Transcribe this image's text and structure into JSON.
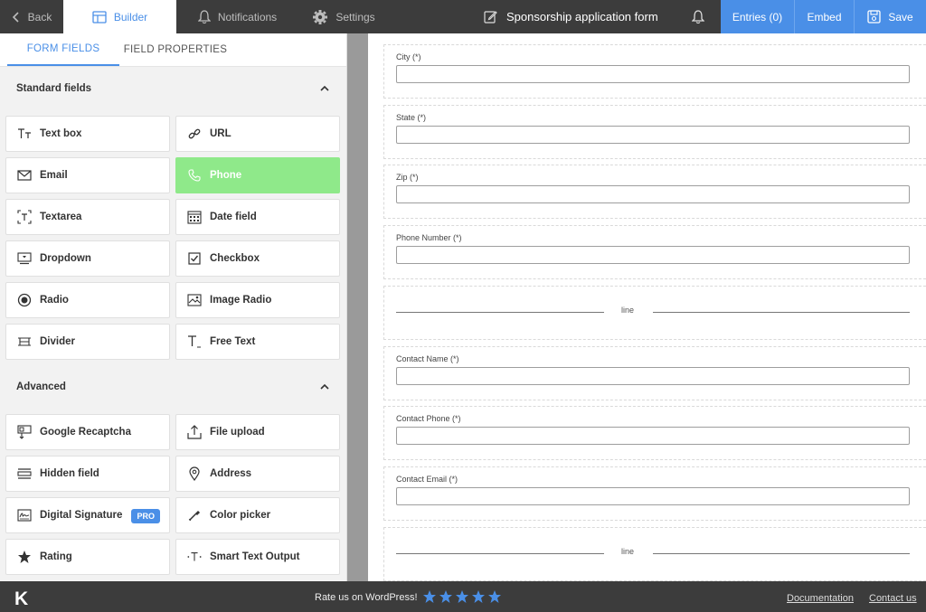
{
  "topbar": {
    "back": "Back",
    "builder": "Builder",
    "notifications": "Notifications",
    "settings": "Settings",
    "form_title": "Sponsorship application form",
    "entries": "Entries (0)",
    "embed": "Embed",
    "save": "Save"
  },
  "sidebar": {
    "tabs": [
      "FORM FIELDS",
      "FIELD PROPERTIES"
    ],
    "standard": {
      "title": "Standard fields",
      "items": [
        {
          "label": "Text box",
          "icon": "text-box-icon"
        },
        {
          "label": "URL",
          "icon": "link-icon"
        },
        {
          "label": "Email",
          "icon": "envelope-icon"
        },
        {
          "label": "Phone",
          "icon": "phone-icon"
        },
        {
          "label": "Textarea",
          "icon": "textarea-icon"
        },
        {
          "label": "Date field",
          "icon": "calendar-icon"
        },
        {
          "label": "Dropdown",
          "icon": "dropdown-icon"
        },
        {
          "label": "Checkbox",
          "icon": "checkbox-icon"
        },
        {
          "label": "Radio",
          "icon": "radio-icon"
        },
        {
          "label": "Image Radio",
          "icon": "image-radio-icon"
        },
        {
          "label": "Divider",
          "icon": "divider-icon"
        },
        {
          "label": "Free Text",
          "icon": "free-text-icon"
        }
      ]
    },
    "advanced": {
      "title": "Advanced",
      "items": [
        {
          "label": "Google Recaptcha",
          "icon": "recaptcha-icon"
        },
        {
          "label": "File upload",
          "icon": "upload-icon"
        },
        {
          "label": "Hidden field",
          "icon": "hidden-field-icon"
        },
        {
          "label": "Address",
          "icon": "map-pin-icon"
        },
        {
          "label": "Digital Signature",
          "icon": "signature-icon",
          "badge": "PRO"
        },
        {
          "label": "Color picker",
          "icon": "color-picker-icon"
        },
        {
          "label": "Rating",
          "icon": "star-icon"
        },
        {
          "label": "Smart Text Output",
          "icon": "smart-text-icon"
        }
      ]
    }
  },
  "canvas": {
    "fields": [
      {
        "type": "input",
        "label": "City (*)"
      },
      {
        "type": "input",
        "label": "State (*)"
      },
      {
        "type": "input",
        "label": "Zip (*)"
      },
      {
        "type": "input",
        "label": "Phone Number (*)"
      },
      {
        "type": "line",
        "label": "line"
      },
      {
        "type": "input",
        "label": "Contact Name (*)"
      },
      {
        "type": "input",
        "label": "Contact Phone (*)"
      },
      {
        "type": "input",
        "label": "Contact Email (*)"
      },
      {
        "type": "line",
        "label": "line"
      }
    ]
  },
  "footer": {
    "logo": "K",
    "rate_text": "Rate us on WordPress!",
    "stars": 5,
    "documentation": "Documentation",
    "contact": "Contact us"
  },
  "colors": {
    "accent": "#4a8fe7",
    "topbar_bg": "#3c3c3c",
    "active_field": "#8fe98a"
  }
}
